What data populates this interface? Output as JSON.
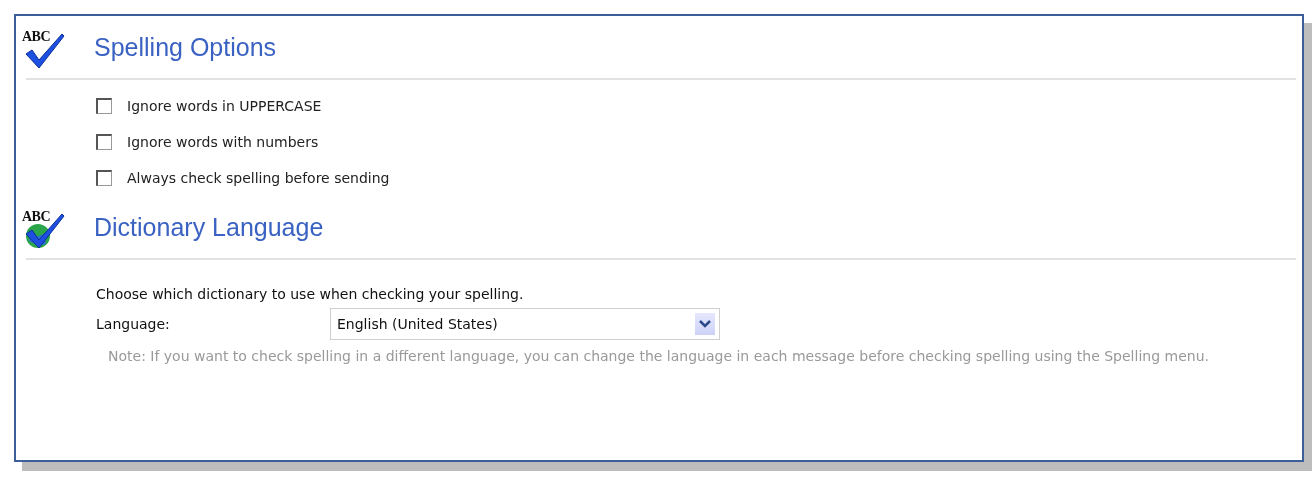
{
  "spelling_options": {
    "title": "Spelling Options",
    "icon_label": "ABC",
    "options": [
      {
        "label": "Ignore words in UPPERCASE",
        "checked": false
      },
      {
        "label": "Ignore words with numbers",
        "checked": false
      },
      {
        "label": "Always check spelling before sending",
        "checked": false
      }
    ]
  },
  "dictionary_language": {
    "title": "Dictionary Language",
    "icon_label": "ABC",
    "description": "Choose which dictionary to use when checking your spelling.",
    "language_label": "Language:",
    "language_value": "English (United States)",
    "note": "Note: If you want to check spelling in a different language, you can change the language in each message before checking spelling using the Spelling menu."
  }
}
